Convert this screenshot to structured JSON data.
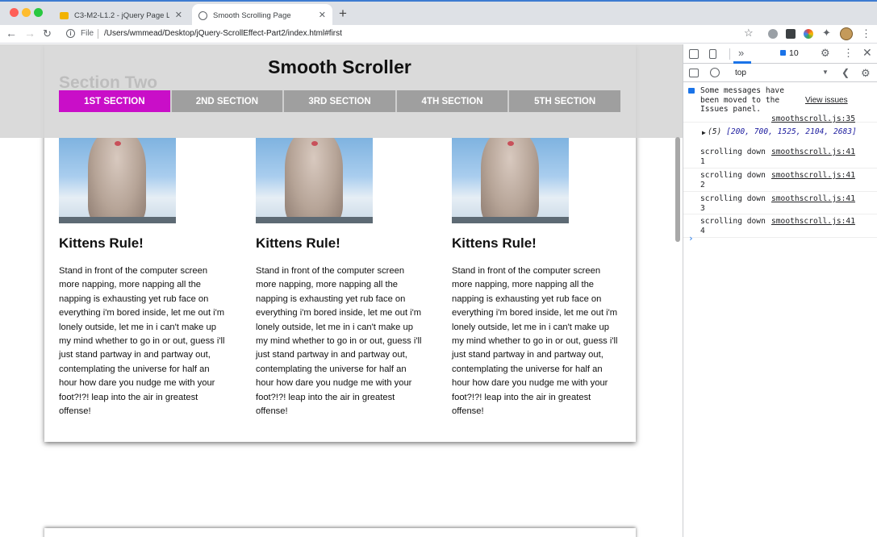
{
  "browser": {
    "tabs": [
      {
        "title": "C3-M2-L1.2 - jQuery Page Loa",
        "active": false
      },
      {
        "title": "Smooth Scrolling Page",
        "active": true
      }
    ],
    "new_tab": "+",
    "close_glyph": "✕",
    "file_label": "File",
    "url": "/Users/wmmead/Desktop/jQuery-ScrollEffect-Part2/index.html#first",
    "icons": {
      "back": "back-arrow-icon",
      "forward": "forward-arrow-icon",
      "reload": "reload-icon",
      "info": "info-icon",
      "star": "bookmark-star-icon",
      "menu": "kebab-menu-icon"
    }
  },
  "page": {
    "title": "Smooth Scroller",
    "ghost_heading": "Section Two",
    "nav": [
      {
        "label": "1ST SECTION",
        "active": true
      },
      {
        "label": "2ND SECTION",
        "active": false
      },
      {
        "label": "3RD SECTION",
        "active": false
      },
      {
        "label": "4TH SECTION",
        "active": false
      },
      {
        "label": "5TH SECTION",
        "active": false
      }
    ],
    "columns": [
      {
        "heading": "Kittens Rule!",
        "text": "Stand in front of the computer screen more napping, more napping all the napping is exhausting yet rub face on everything i'm bored inside, let me out i'm lonely outside, let me in i can't make up my mind whether to go in or out, guess i'll just stand partway in and partway out, contemplating the universe for half an hour how dare you nudge me with your foot?!?! leap into the air in greatest offense!"
      },
      {
        "heading": "Kittens Rule!",
        "text": "Stand in front of the computer screen more napping, more napping all the napping is exhausting yet rub face on everything i'm bored inside, let me out i'm lonely outside, let me in i can't make up my mind whether to go in or out, guess i'll just stand partway in and partway out, contemplating the universe for half an hour how dare you nudge me with your foot?!?! leap into the air in greatest offense!"
      },
      {
        "heading": "Kittens Rule!",
        "text": "Stand in front of the computer screen more napping, more napping all the napping is exhausting yet rub face on everything i'm bored inside, let me out i'm lonely outside, let me in i can't make up my mind whether to go in or out, guess i'll just stand partway in and partway out, contemplating the universe for half an hour how dare you nudge me with your foot?!?! leap into the air in greatest offense!"
      }
    ],
    "accent_color": "#c90ec8",
    "nav_color": "#9f9f9f"
  },
  "devtools": {
    "more_tabs": "»",
    "issues_count": "10",
    "context": "top",
    "console": {
      "info_message": "Some messages have been moved to the Issues panel.",
      "info_link": "View issues",
      "first_source": "smoothscroll.js:35",
      "array_length": "(5)",
      "array_values": "[200, 700, 1525, 2104, 2683]",
      "logs": [
        {
          "text": "scrolling down",
          "source": "smoothscroll.js:41",
          "value": "1"
        },
        {
          "text": "scrolling down",
          "source": "smoothscroll.js:41",
          "value": "2"
        },
        {
          "text": "scrolling down",
          "source": "smoothscroll.js:41",
          "value": "3"
        },
        {
          "text": "scrolling down",
          "source": "smoothscroll.js:41",
          "value": "4"
        }
      ],
      "prompt": "›"
    }
  }
}
